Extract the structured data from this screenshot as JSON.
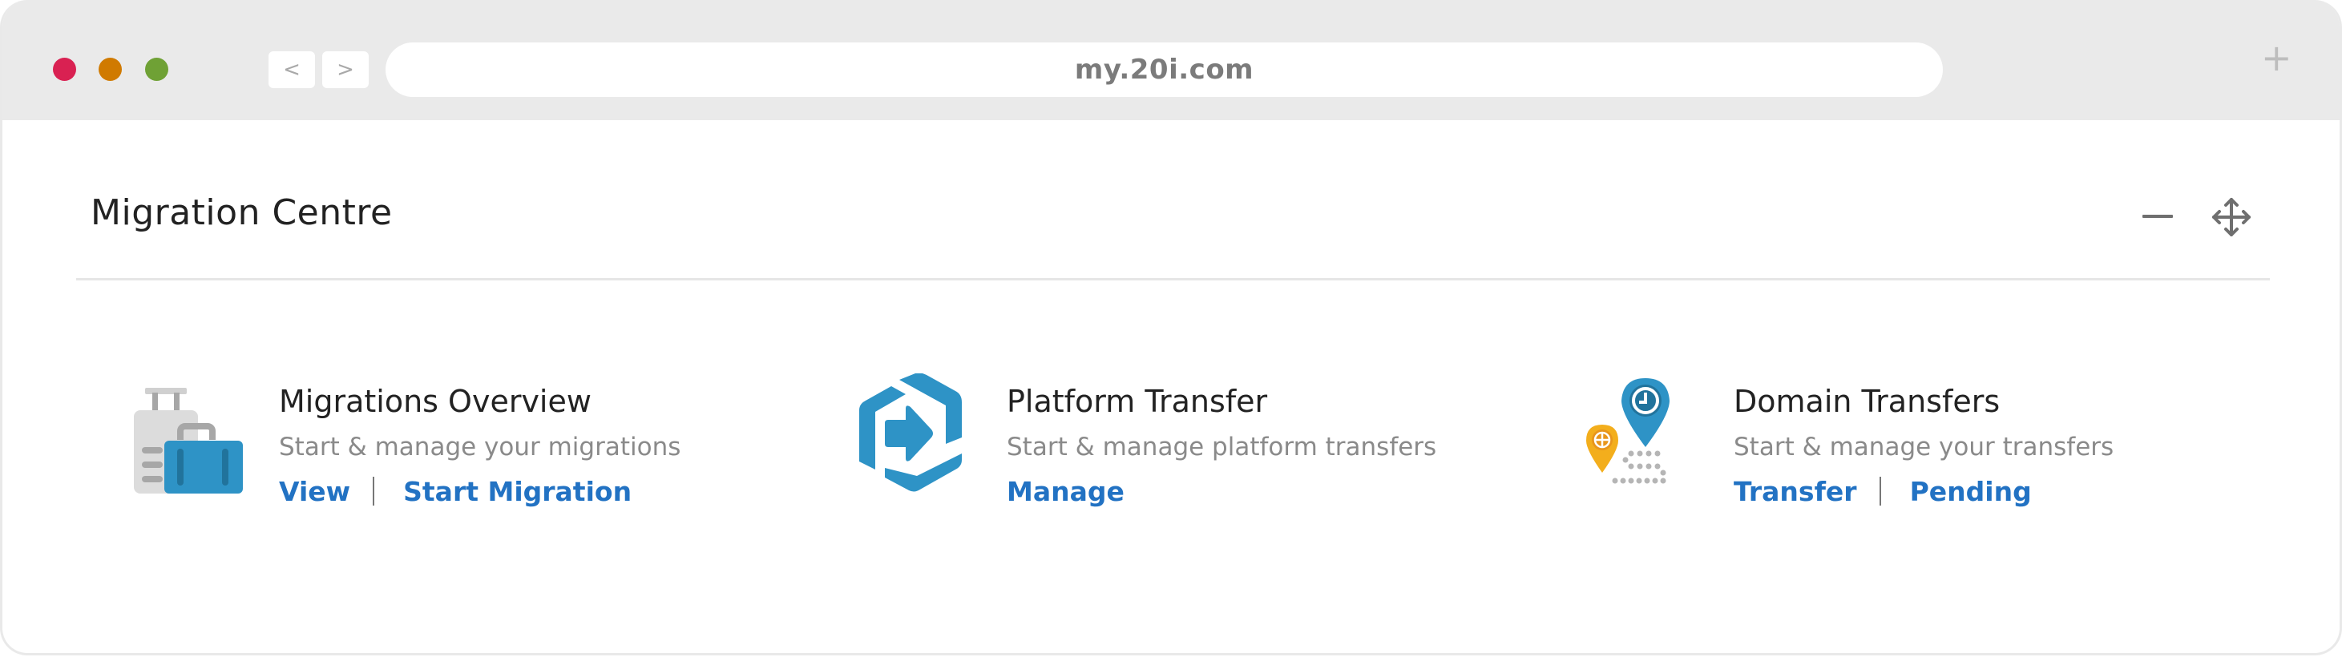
{
  "browser": {
    "url": "my.20i.com",
    "back_label": "<",
    "forward_label": ">",
    "new_tab_label": "+",
    "traffic_lights": {
      "close": "#D92152",
      "minimize": "#D07A00",
      "maximize": "#6FA135"
    }
  },
  "panel": {
    "title": "Migration Centre",
    "actions": [
      {
        "name": "minimize",
        "icon": "minus-icon"
      },
      {
        "name": "move",
        "icon": "move-arrows-icon"
      }
    ]
  },
  "cards": [
    {
      "icon": "luggage-icon",
      "title": "Migrations Overview",
      "subtitle": "Start & manage your migrations",
      "links": [
        "View",
        "Start Migration"
      ]
    },
    {
      "icon": "platform-transfer-icon",
      "title": "Platform Transfer",
      "subtitle": "Start & manage platform transfers",
      "links": [
        "Manage"
      ]
    },
    {
      "icon": "domain-route-pins-icon",
      "title": "Domain Transfers",
      "subtitle": "Start & manage your transfers",
      "links": [
        "Transfer",
        "Pending"
      ]
    }
  ],
  "colors": {
    "link": "#2272C3",
    "icon_blue": "#2E93C6",
    "icon_orange": "#F3AE1C"
  }
}
